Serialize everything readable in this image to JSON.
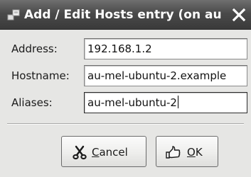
{
  "window": {
    "title": "Add / Edit Hosts entry (on au"
  },
  "form": {
    "address": {
      "label": "Address:",
      "value": "192.168.1.2"
    },
    "hostname": {
      "label": "Hostname:",
      "value": "au-mel-ubuntu-2.example"
    },
    "aliases": {
      "label": "Aliases:",
      "value": "au-mel-ubuntu-2"
    }
  },
  "buttons": {
    "cancel_label": "Cancel",
    "ok_label": "OK"
  },
  "icons": {
    "title": "network-icon",
    "close": "close-icon",
    "cancel": "scissors-icon",
    "ok": "hand-thumbs-up-icon"
  },
  "colors": {
    "titlebar": "#4a4a4a",
    "window_bg": "#e6e6e4",
    "field_bg": "#ffffff"
  }
}
